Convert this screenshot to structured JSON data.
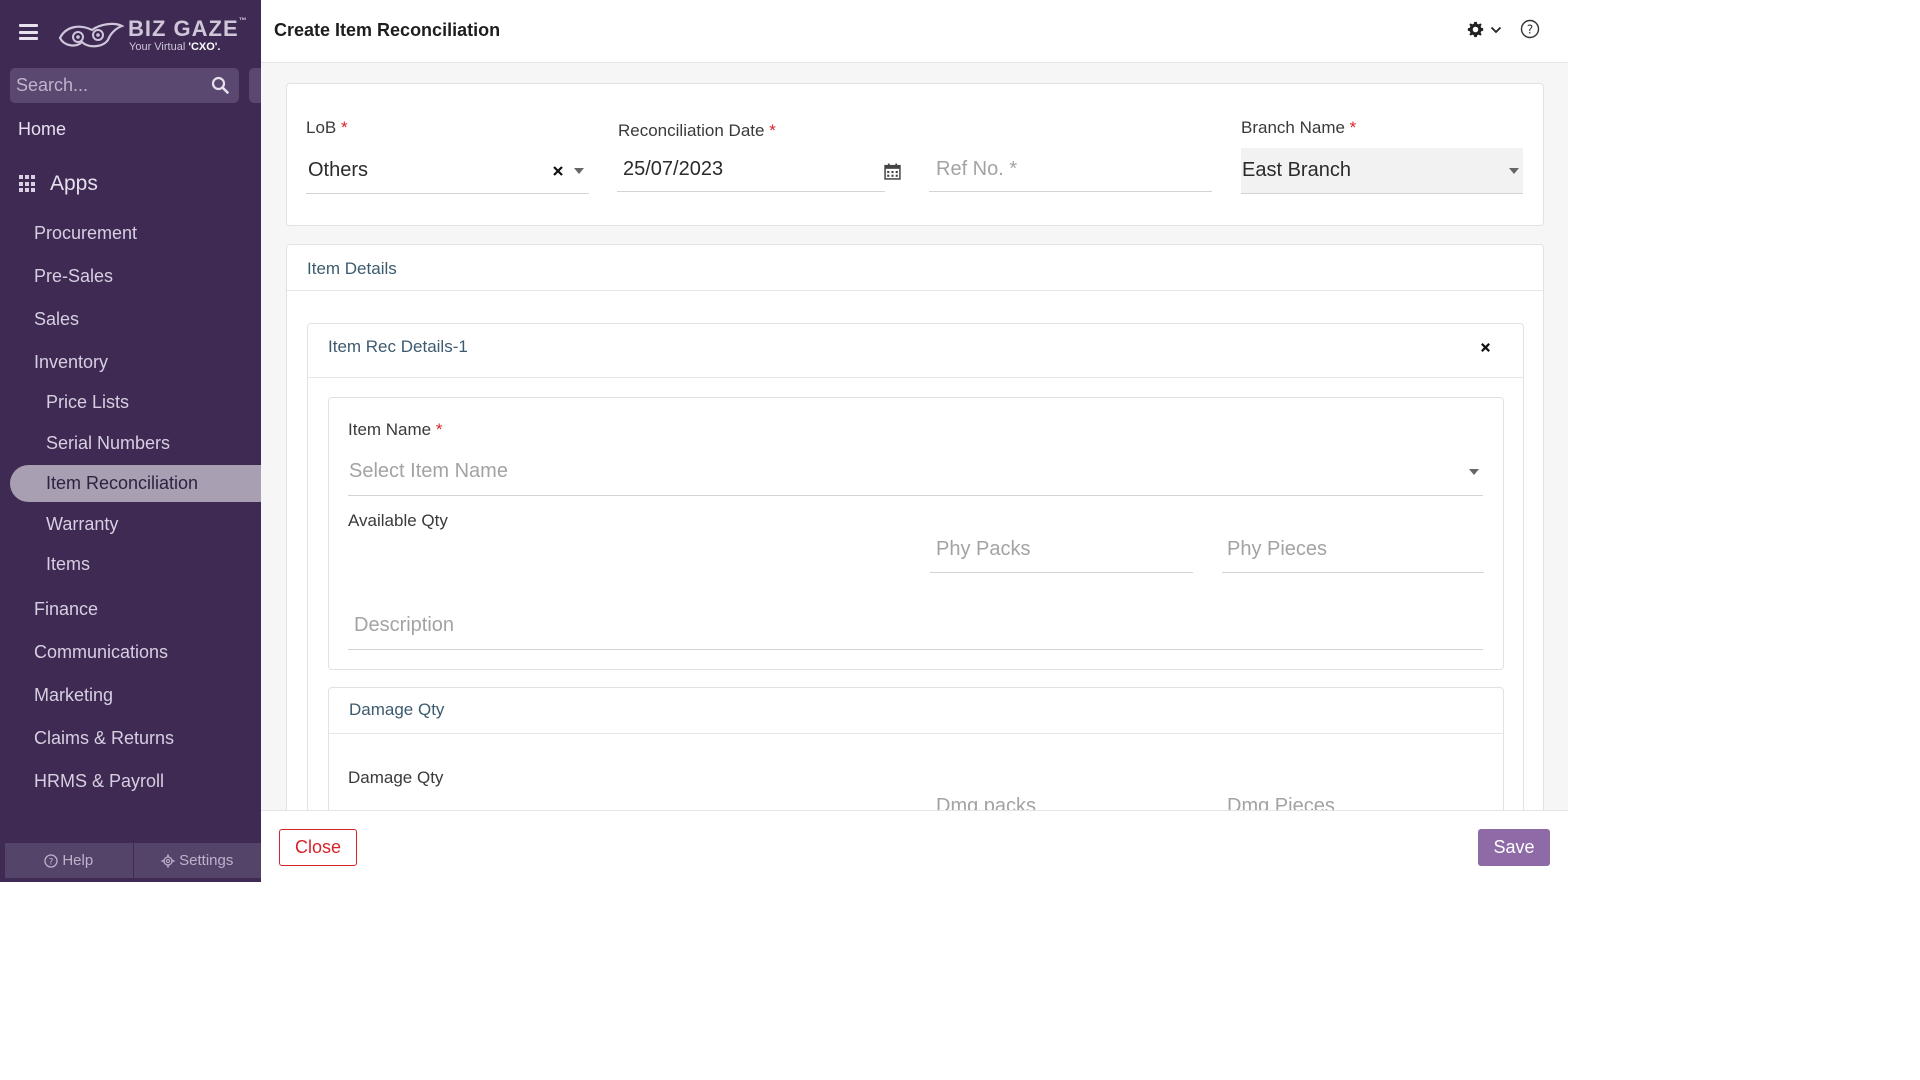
{
  "sidebar": {
    "logo": {
      "brand": "BIZ GAZE",
      "tm": "™",
      "tagline_prefix": "Your Virtual ",
      "tagline_bold": "'CXO'."
    },
    "search": {
      "placeholder": "Search..."
    },
    "home": "Home",
    "apps": "Apps",
    "items": [
      {
        "label": "Procurement"
      },
      {
        "label": "Pre-Sales"
      },
      {
        "label": "Sales"
      },
      {
        "label": "Inventory"
      },
      {
        "label": "Price Lists"
      },
      {
        "label": "Serial Numbers"
      },
      {
        "label": "Item Reconciliation",
        "active": true
      },
      {
        "label": "Warranty"
      },
      {
        "label": "Items"
      },
      {
        "label": "Finance"
      },
      {
        "label": "Communications"
      },
      {
        "label": "Marketing"
      },
      {
        "label": "Claims & Returns"
      },
      {
        "label": "HRMS & Payroll"
      }
    ],
    "footer": {
      "help": "Help",
      "settings": "Settings"
    }
  },
  "header": {
    "title": "Create Item Reconciliation"
  },
  "form": {
    "lob": {
      "label": "LoB",
      "required": "*",
      "value": "Others"
    },
    "rec_date": {
      "label": "Reconciliation Date",
      "required": "*",
      "value": "25/07/2023"
    },
    "ref_no": {
      "placeholder": "Ref No. *"
    },
    "branch": {
      "label": "Branch Name",
      "required": "*",
      "value": "East Branch"
    }
  },
  "item_details": {
    "title": "Item Details",
    "rec": {
      "title": "Item Rec Details-1",
      "item_name": {
        "label": "Item Name",
        "required": "*",
        "placeholder": "Select Item Name"
      },
      "available_qty": {
        "label": "Available Qty"
      },
      "phy_packs": {
        "placeholder": "Phy  Packs"
      },
      "phy_pieces": {
        "placeholder": "Phy  Pieces"
      },
      "description": {
        "placeholder": "Description"
      },
      "damage": {
        "title": "Damage Qty",
        "label": "Damage Qty",
        "dmg_packs": {
          "placeholder": "Dmg packs"
        },
        "dmg_pieces": {
          "placeholder": "Dmg Pieces"
        }
      }
    }
  },
  "footer": {
    "close": "Close",
    "save": "Save"
  },
  "colors": {
    "sidebar_bg": "#3e2a52",
    "accent": "#8e6aa6",
    "danger": "#d8232a",
    "section_title": "#3c5a6e"
  }
}
